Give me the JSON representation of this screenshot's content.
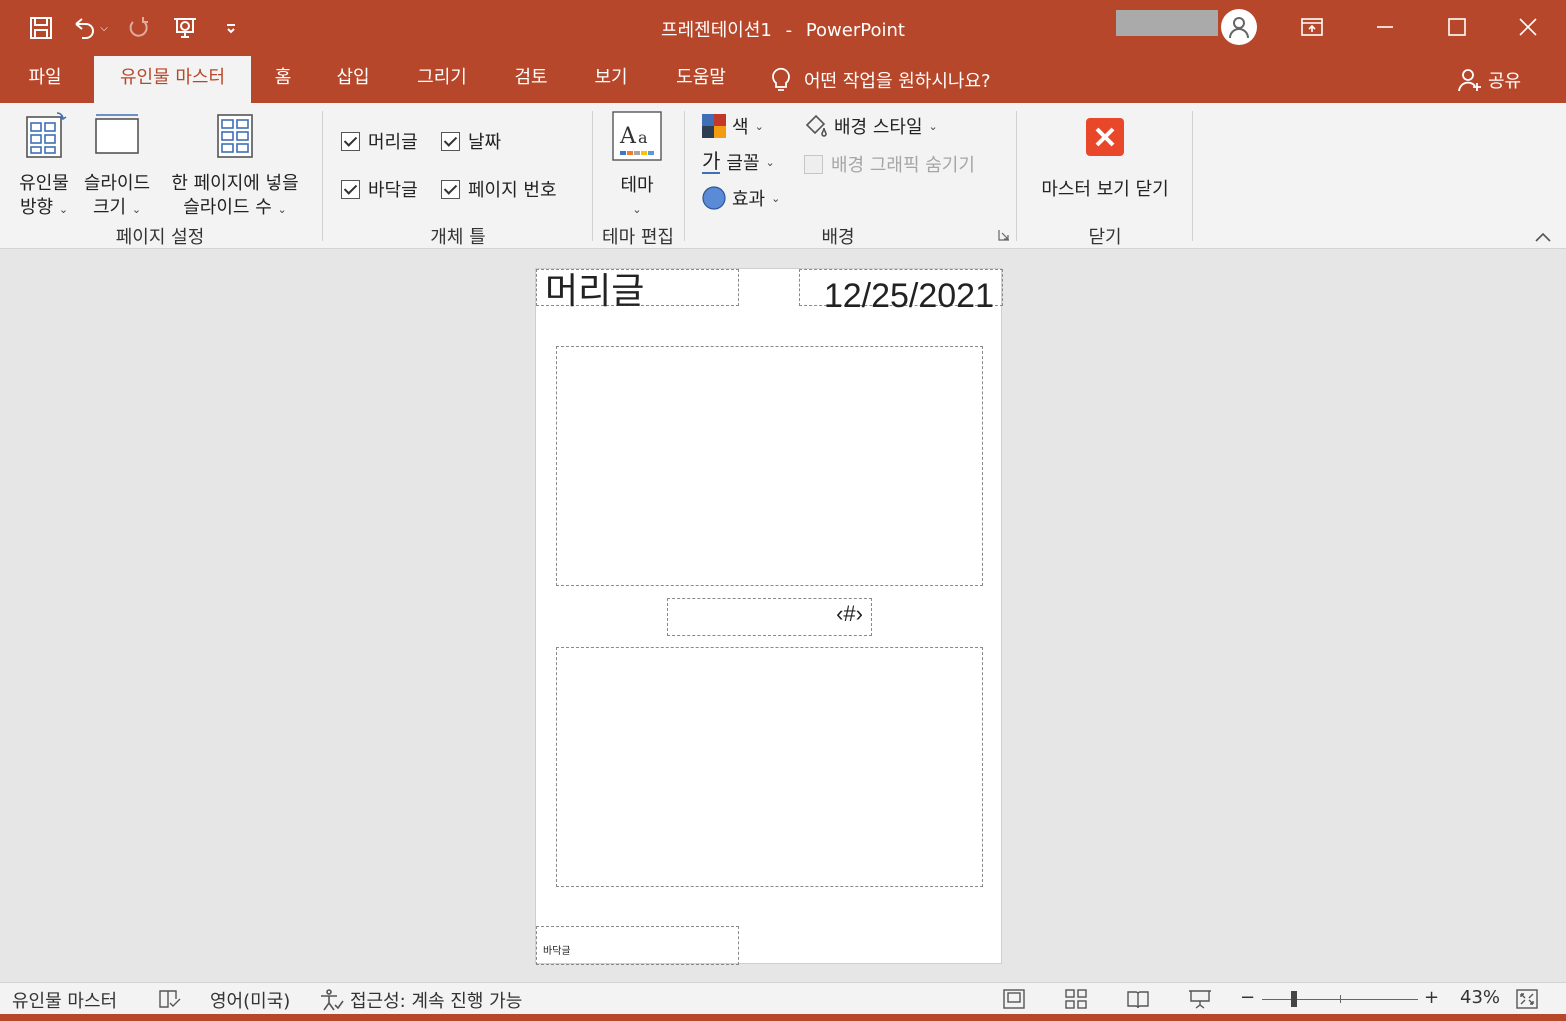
{
  "window": {
    "doc_title": "프레젠테이션1",
    "separator": "-",
    "app_name": "PowerPoint"
  },
  "tabs": [
    {
      "label": "파일"
    },
    {
      "label": "유인물 마스터"
    },
    {
      "label": "홈"
    },
    {
      "label": "삽입"
    },
    {
      "label": "그리기"
    },
    {
      "label": "검토"
    },
    {
      "label": "보기"
    },
    {
      "label": "도움말"
    }
  ],
  "tell_me": "어떤 작업을 원하시나요?",
  "share_label": "공유",
  "ribbon": {
    "page_setup": {
      "orientation_line1": "유인물",
      "orientation_line2": "방향",
      "slide_size_line1": "슬라이드",
      "slide_size_line2": "크기",
      "per_page_line1": "한 페이지에 넣을",
      "per_page_line2": "슬라이드 수",
      "group": "페이지 설정"
    },
    "placeholders": {
      "header": "머리글",
      "date": "날짜",
      "footer": "바닥글",
      "page_number": "페이지 번호",
      "group": "개체 틀"
    },
    "edit_theme": {
      "theme": "테마",
      "group": "테마 편집"
    },
    "background": {
      "colors": "색",
      "fonts": "글꼴",
      "fonts_glyph": "가",
      "effects": "효과",
      "bg_styles": "배경 스타일",
      "hide_graphics": "배경 그래픽 숨기기",
      "group": "배경"
    },
    "close": {
      "close_master": "마스터 보기 닫기",
      "group": "닫기"
    }
  },
  "canvas": {
    "header_text": "머리글",
    "date_text": "12/25/2021",
    "page_number_text": "‹#›",
    "footer_text": "바닥글"
  },
  "status": {
    "view_name": "유인물 마스터",
    "language": "영어(미국)",
    "accessibility": "접근성: 계속 진행 가능",
    "zoom_minus": "−",
    "zoom_plus": "+",
    "zoom_level": "43%"
  },
  "colors": {
    "accent": "#b7472a",
    "close_red": "#e8472a"
  }
}
